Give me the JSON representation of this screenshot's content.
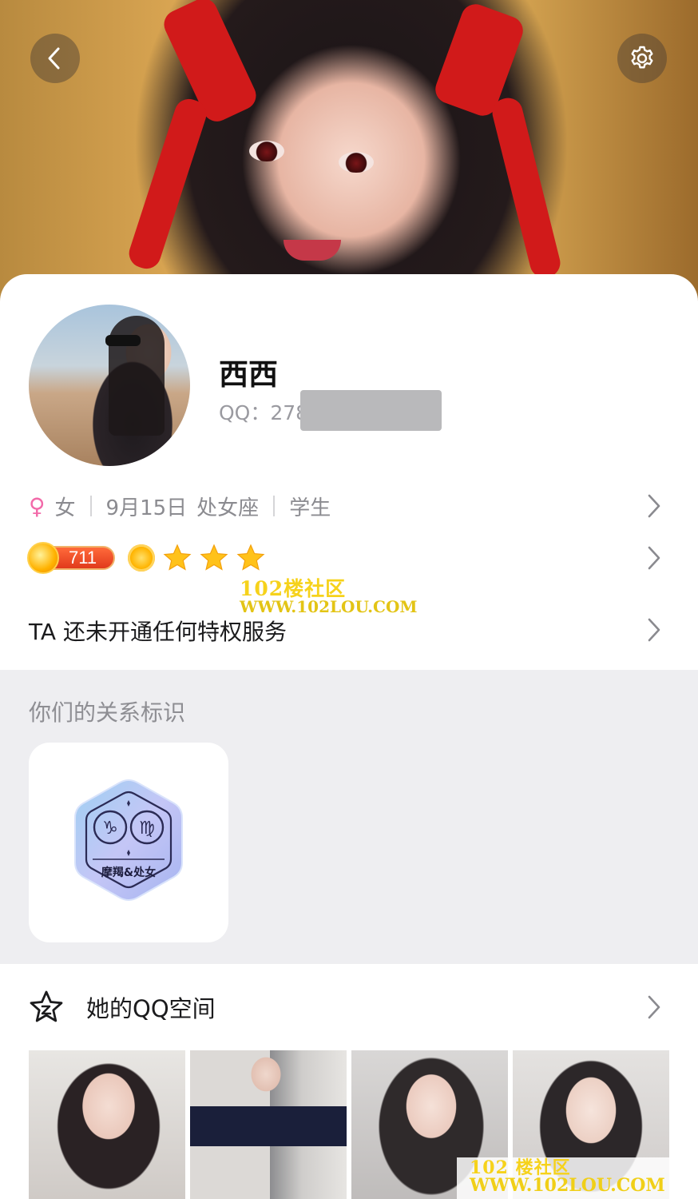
{
  "profile": {
    "name": "西西",
    "qq_label": "QQ：278",
    "gender_symbol": "♀",
    "gender": "女",
    "birthday": "9月15日",
    "zodiac": "处女座",
    "occupation": "学生",
    "level_number": "711",
    "privilege_text": "TA 还未开通任何特权服务"
  },
  "watermark": {
    "line1": "102楼社区",
    "line2": "WWW.102LOU.COM",
    "line1_bottom": "102 楼社区",
    "line2_bottom": "WWW.102LOU.COM"
  },
  "relationship": {
    "title": "你们的关系标识",
    "badge_label": "摩羯&处女"
  },
  "qzone": {
    "title": "她的QQ空间"
  },
  "icons": {
    "back": "chevron-left-icon",
    "settings": "gear-icon",
    "qzone": "star-icon"
  },
  "colors": {
    "female": "#f26aa9",
    "star": "#ffc21a",
    "card_bg": "#ffffff",
    "section_bg": "#eeeef1"
  }
}
